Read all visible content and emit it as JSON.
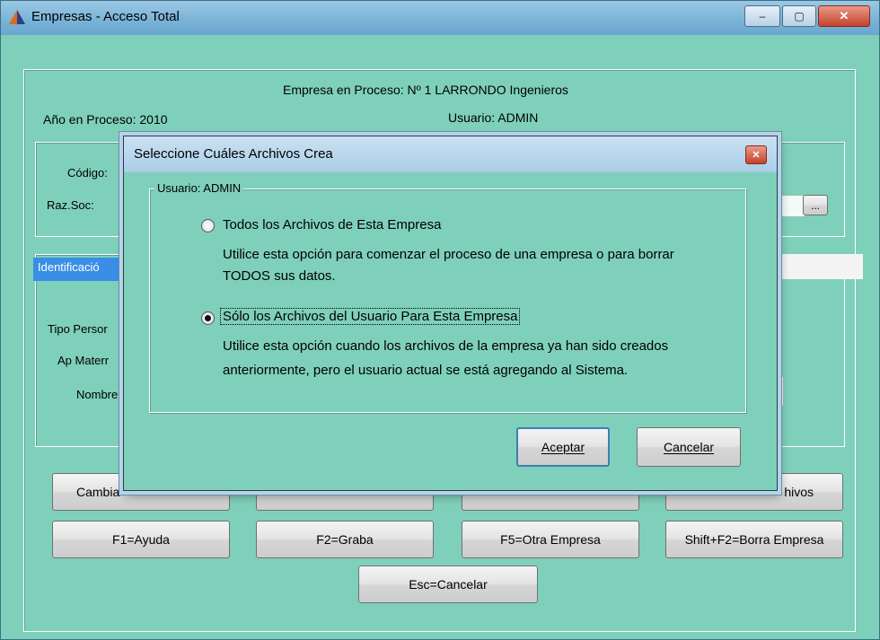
{
  "window": {
    "title": "Empresas - Acceso Total",
    "min_glyph": "–",
    "max_glyph": "▢",
    "close_glyph": "✕"
  },
  "header": {
    "empresa_en_proceso": "Empresa en Proceso: Nº 1 LARRONDO Ingenieros",
    "anio_en_proceso": "Año en Proceso: 2010",
    "usuario": "Usuario: ADMIN"
  },
  "company": {
    "codigo_label": "Código:",
    "razsoc_label": "Raz.Soc:",
    "dots_label": "..."
  },
  "ident": {
    "tab_label": "Identificació",
    "tipo_persona_label": "Tipo Persor",
    "ap_materno_label": "Ap Materr",
    "nombre_label": "Nombre"
  },
  "buttons": {
    "cambia_label": "Cambia",
    "archivos_label": "hivos",
    "f1_label": "F1=Ayuda",
    "f2_label": "F2=Graba",
    "f5_label": "F5=Otra Empresa",
    "shift_f2_label": "Shift+F2=Borra Empresa",
    "esc_label": "Esc=Cancelar"
  },
  "dialog": {
    "title": "Seleccione Cuáles Archivos Crea",
    "close_glyph": "✕",
    "group_legend": "Usuario: ADMIN",
    "option1": {
      "label": "Todos los Archivos de Esta Empresa",
      "desc_line1": "Utilice esta opción para comenzar el proceso de una empresa o para borrar",
      "desc_line2": "TODOS sus datos.",
      "selected": false
    },
    "option2": {
      "label": "Sólo los Archivos del Usuario Para Esta Empresa",
      "desc_line1": "Utilice esta opción cuando los archivos de la empresa ya han sido creados",
      "desc_line2": "anteriormente, pero el usuario actual se está agregando al Sistema.",
      "selected": true
    },
    "accept_label": "Aceptar",
    "cancel_label": "Cancelar"
  },
  "colors": {
    "window_bg": "#7fd0ba",
    "titlebar": "#7bb4d8",
    "tab_selected": "#3a8ee6"
  }
}
